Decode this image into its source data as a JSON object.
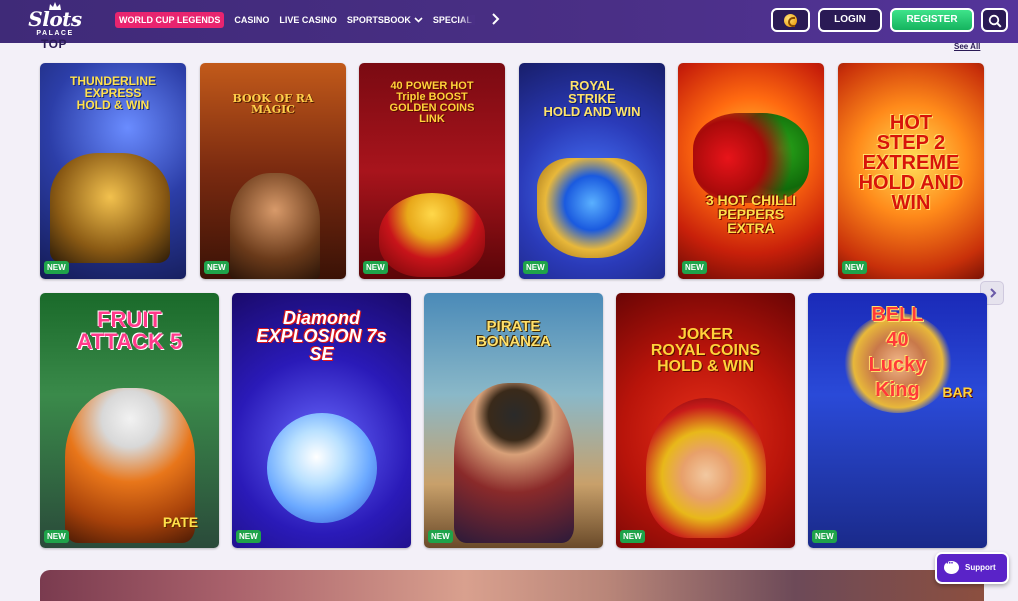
{
  "header": {
    "logo": {
      "wordmark": "Slots",
      "sub": "PALACE"
    },
    "nav": [
      {
        "label": "WORLD CUP LEGENDS",
        "highlight": true
      },
      {
        "label": "CASINO"
      },
      {
        "label": "LIVE CASINO"
      },
      {
        "label": "SPORTSBOOK",
        "dropdown": true
      },
      {
        "label": "SPECIAL"
      }
    ],
    "login_label": "LOGIN",
    "register_label": "REGISTER",
    "accent": "#e8246f",
    "register_color": "#1fbf68"
  },
  "section": {
    "title": "TOP",
    "see_all": "See All"
  },
  "games_row1": [
    {
      "title": "THUNDERLINE\nEXPRESS\nHOLD & WIN",
      "badge": "NEW"
    },
    {
      "title": "BOOK OF RA\nMAGIC",
      "badge": "NEW"
    },
    {
      "title": "40 POWER HOT\nTriple BOOST\nGOLDEN COINS\nLINK",
      "badge": "NEW"
    },
    {
      "title": "ROYAL\nSTRIKE\nHOLD AND WIN",
      "badge": "NEW"
    },
    {
      "title": "3 HOT CHILLI\nPEPPERS\nEXTRA",
      "badge": "NEW"
    },
    {
      "title": "HOT\nSTEP 2\nEXTREME\nHOLD AND WIN",
      "badge": "NEW"
    }
  ],
  "games_row2": [
    {
      "title": "FRUIT\nATTACK 5",
      "caption": "PATE",
      "badge": "NEW"
    },
    {
      "title": "Diamond\nEXPLOSION 7s\nSE",
      "badge": "NEW"
    },
    {
      "title": "PIRATE\nBONANZA",
      "badge": "NEW"
    },
    {
      "title": "JOKER\nROYAL COINS\nHOLD & WIN",
      "badge": "NEW"
    },
    {
      "title": "BELL\n40\nLucky\nKing",
      "caption": "BAR",
      "badge": "NEW"
    }
  ],
  "support_label": "Support"
}
